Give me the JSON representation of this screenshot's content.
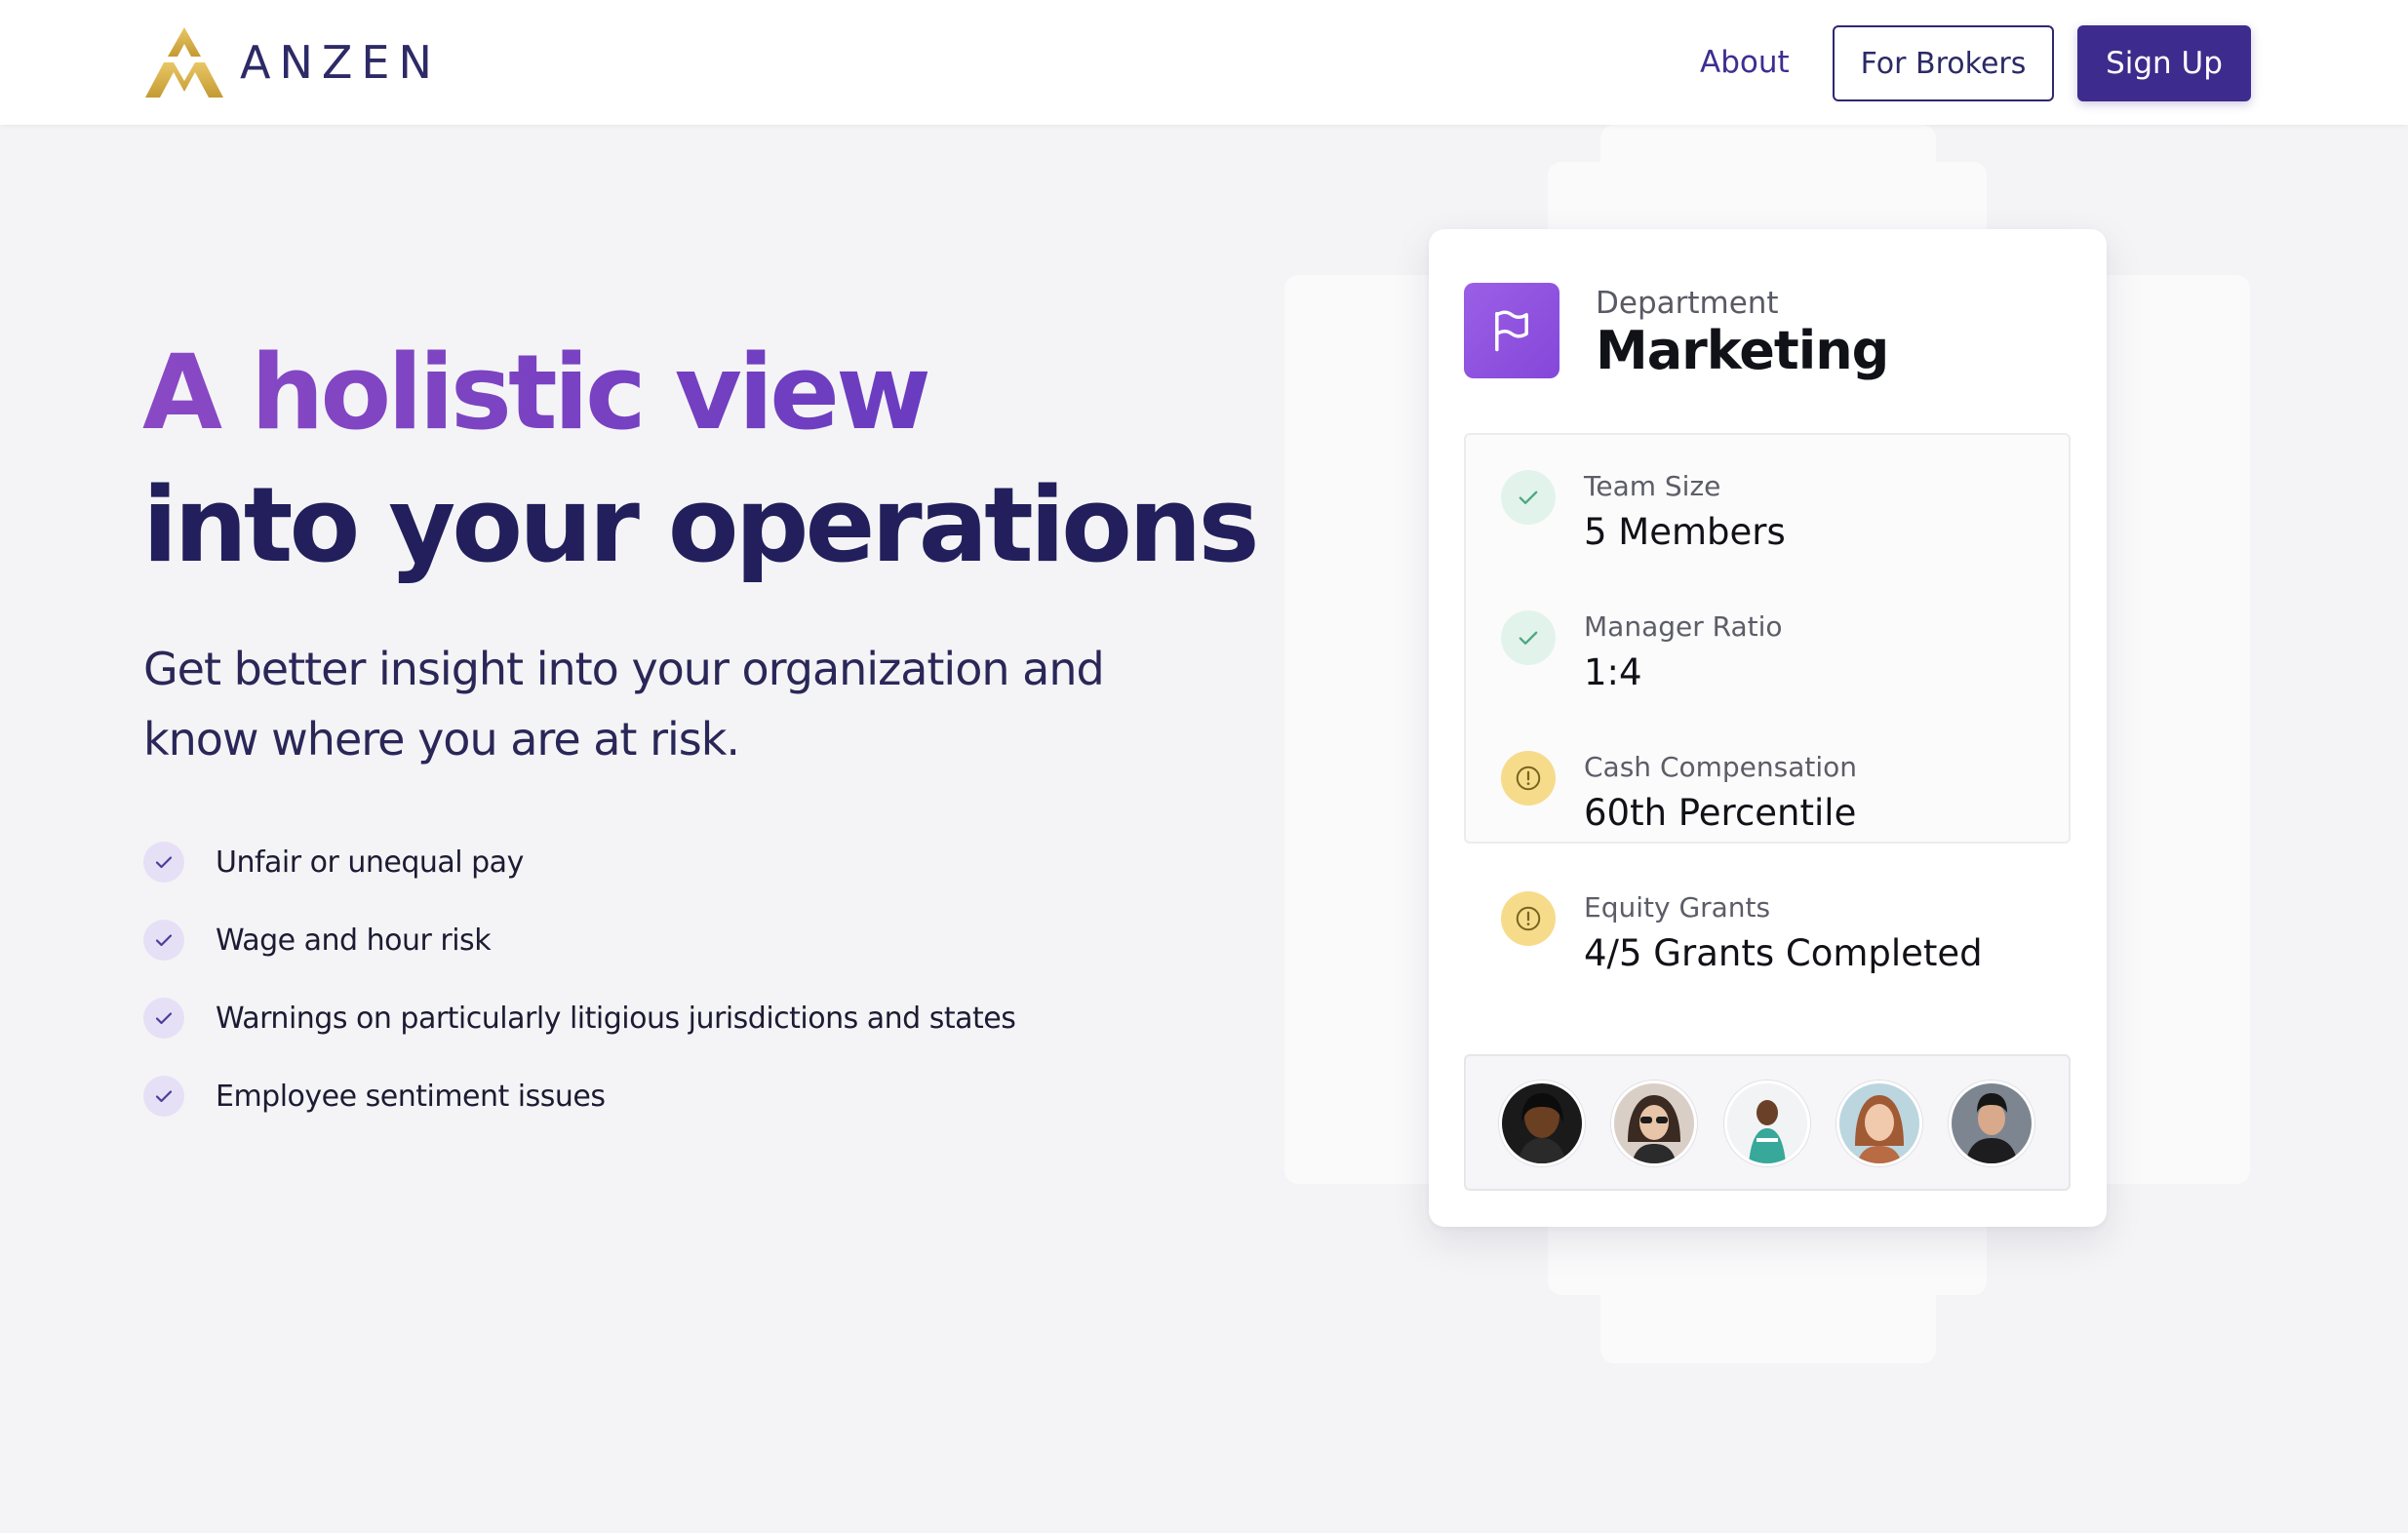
{
  "header": {
    "logo_alt": "Anzen logo mark",
    "brand": "ANZEN",
    "nav_about": "About",
    "brokers_button": "For Brokers",
    "signup_button": "Sign Up"
  },
  "hero": {
    "title_line1": "A holistic view",
    "title_line2": "into your operations",
    "subtitle_line1": "Get better insight into your organization and",
    "subtitle_line2": "know where you are at risk.",
    "bullets": [
      "Unfair or unequal pay",
      "Wage and hour risk",
      "Warnings on particularly litigious jurisdictions and states",
      "Employee sentiment issues"
    ]
  },
  "card": {
    "department_label": "Department",
    "department_value": "Marketing",
    "stats": [
      {
        "label": "Team Size",
        "value": "5 Members",
        "status": "ok",
        "icon": "check-icon"
      },
      {
        "label": "Manager Ratio",
        "value": "1:4",
        "status": "ok",
        "icon": "check-icon"
      },
      {
        "label": "Cash Compensation",
        "value": "60th Percentile",
        "status": "warning",
        "icon": "alert-icon"
      },
      {
        "label": "Equity Grants",
        "value": "4/5 Grants Completed",
        "status": "warning",
        "icon": "alert-icon"
      }
    ],
    "avatars": [
      "avatar-1",
      "avatar-2",
      "avatar-3",
      "avatar-4",
      "avatar-5"
    ]
  },
  "colors": {
    "brand_purple": "#3d2c8d",
    "title_gradient_start": "#8a49c4",
    "title_dark": "#221f5c",
    "logo_gold": "#d8b24a",
    "ok_green": "#4ea880",
    "warn_yellow": "#f6dc8a"
  }
}
